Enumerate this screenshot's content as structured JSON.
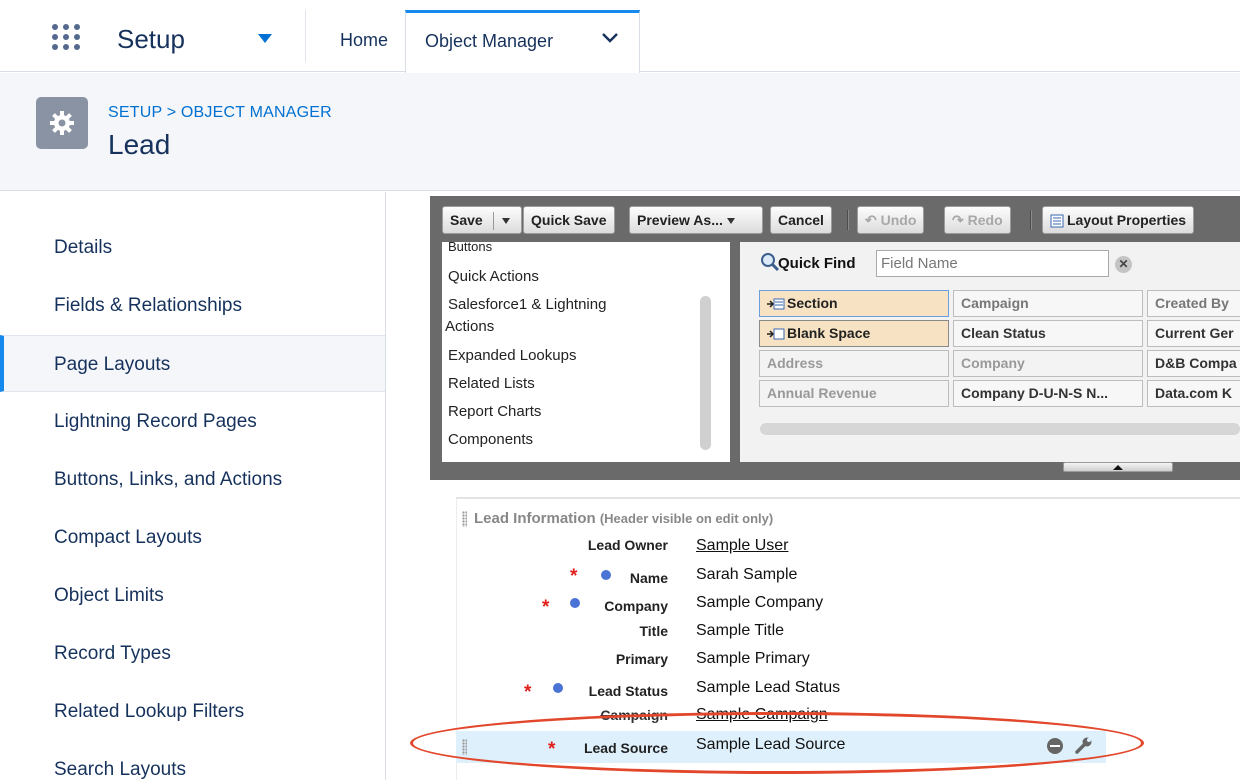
{
  "topnav": {
    "app_name": "Setup",
    "tabs": [
      {
        "label": "Home"
      },
      {
        "label": "Object Manager"
      }
    ]
  },
  "header": {
    "breadcrumb_root": "SETUP",
    "breadcrumb_sep": " > ",
    "breadcrumb_current": "OBJECT MANAGER",
    "title": "Lead"
  },
  "sidebar": {
    "items": [
      {
        "label": "Details"
      },
      {
        "label": "Fields & Relationships"
      },
      {
        "label": "Page Layouts"
      },
      {
        "label": "Lightning Record Pages"
      },
      {
        "label": "Buttons, Links, and Actions"
      },
      {
        "label": "Compact Layouts"
      },
      {
        "label": "Object Limits"
      },
      {
        "label": "Record Types"
      },
      {
        "label": "Related Lookup Filters"
      },
      {
        "label": "Search Layouts"
      }
    ],
    "active_index": 2
  },
  "toolbar": {
    "save": "Save",
    "quick_save": "Quick Save",
    "preview_as": "Preview As...",
    "cancel": "Cancel",
    "undo": "Undo",
    "redo": "Redo",
    "layout_properties": "Layout Properties"
  },
  "palette": {
    "categories": [
      "Buttons",
      "Quick Actions",
      "Salesforce1 & Lightning",
      "Actions",
      "Expanded Lookups",
      "Related Lists",
      "Report Charts",
      "Components"
    ],
    "quick_find_label": "Quick Find",
    "quick_find_placeholder": "Field Name",
    "fields": [
      [
        "Section",
        "Campaign",
        "Created By"
      ],
      [
        "Blank Space",
        "Clean Status",
        "Current Ger"
      ],
      [
        "Address",
        "Company",
        "D&B Compa"
      ],
      [
        "Annual Revenue",
        "Company D-U-N-S N...",
        "Data.com K"
      ]
    ]
  },
  "section": {
    "title": "Lead Information",
    "note": "(Header visible on edit only)",
    "rows": [
      {
        "label": "Lead Owner",
        "value": "Sample User"
      },
      {
        "label": "Name",
        "value": "Sarah Sample"
      },
      {
        "label": "Company",
        "value": "Sample Company"
      },
      {
        "label": "Title",
        "value": "Sample Title"
      },
      {
        "label": "Primary",
        "value": "Sample Primary"
      },
      {
        "label": "Lead Status",
        "value": "Sample Lead Status"
      },
      {
        "label": "Campaign",
        "value": "Sample Campaign"
      },
      {
        "label": "Lead Source",
        "value": "Sample Lead Source"
      }
    ]
  },
  "colors": {
    "accent": "#1589ee",
    "link": "#0070d2",
    "required": "#e0201c",
    "highlight": "#e2472b"
  }
}
